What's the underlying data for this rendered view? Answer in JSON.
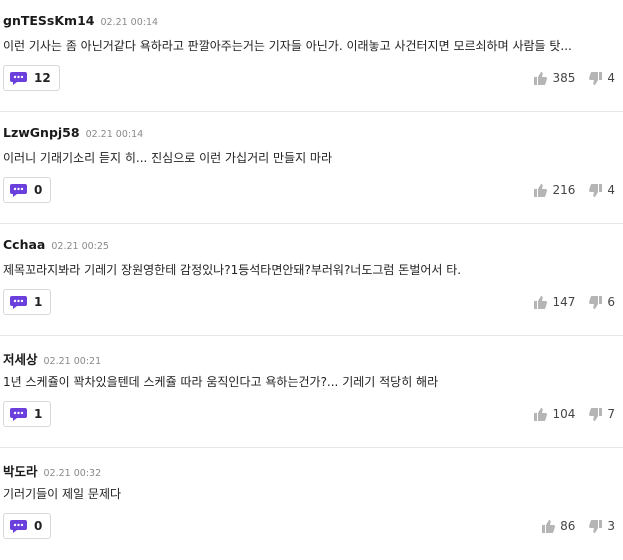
{
  "colors": {
    "accent": "#6a3fdb",
    "icon_gray": "#b5b5b5",
    "divider": "#e6e6e6"
  },
  "icons": {
    "reply": "speech-bubble-icon",
    "like": "thumbs-up-icon",
    "dislike": "thumbs-down-icon"
  },
  "comments": [
    {
      "nickname": "gnTESsKm14",
      "time": "02.21 00:14",
      "text": "이런 기사는 좀 아닌거같다 욕하라고 판깔아주는거는 기자들 아닌가. 이래놓고 사건터지면 모르쇠하며 사람들 탓...",
      "replies": "12",
      "likes": "385",
      "dislikes": "4"
    },
    {
      "nickname": "LzwGnpj58",
      "time": "02.21 00:14",
      "text": "이러니 기래기소리 듣지 히... 진심으로 이런 가십거리 만들지 마라",
      "replies": "0",
      "likes": "216",
      "dislikes": "4"
    },
    {
      "nickname": "Cchaa",
      "time": "02.21 00:25",
      "text": "제목꼬라지봐라 기레기 장원영한테 감정있나?1등석타면안돼?부러워?너도그럼 돈벌어서 타.",
      "replies": "1",
      "likes": "147",
      "dislikes": "6"
    },
    {
      "nickname": "저세상",
      "time": "02.21 00:21",
      "text": "1년 스케쥴이 꽉차있을텐데 스케쥴 따라 움직인다고 욕하는건가?... 기레기 적당히 해라",
      "replies": "1",
      "likes": "104",
      "dislikes": "7"
    },
    {
      "nickname": "박도라",
      "time": "02.21 00:32",
      "text": "기러기들이 제일 문제다",
      "replies": "0",
      "likes": "86",
      "dislikes": "3"
    }
  ]
}
